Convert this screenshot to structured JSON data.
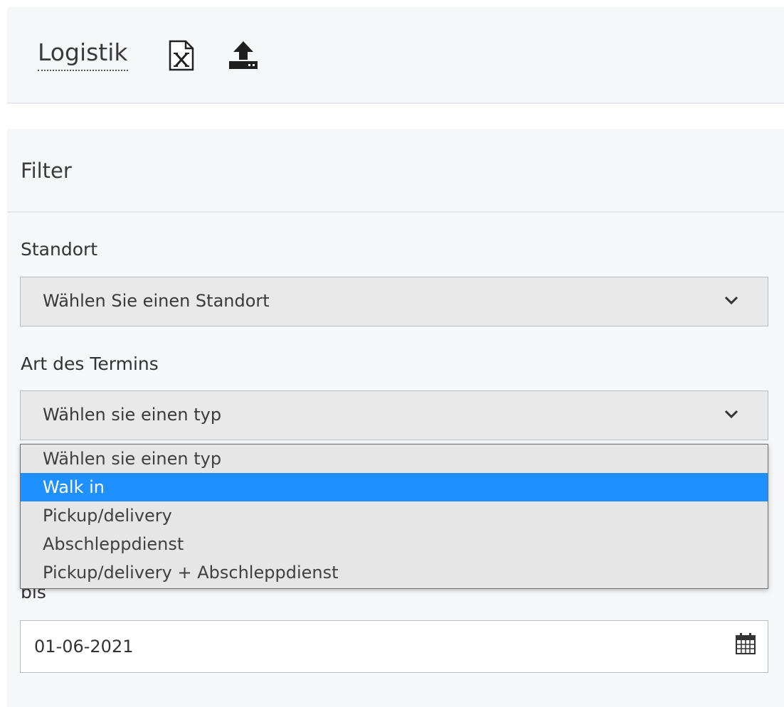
{
  "header": {
    "title": "Logistik",
    "icons": [
      "excel-export-icon",
      "upload-icon"
    ]
  },
  "filter": {
    "title": "Filter",
    "standort": {
      "label": "Standort",
      "selected": "Wählen Sie einen Standort"
    },
    "termin_art": {
      "label": "Art des Termins",
      "selected": "Wählen sie einen typ",
      "options": [
        "Wählen sie einen typ",
        "Walk in",
        "Pickup/delivery",
        "Abschleppdienst",
        "Pickup/delivery + Abschleppdienst"
      ],
      "highlighted_option": "Walk in"
    },
    "bis": {
      "label": "bis",
      "value": "01-06-2021"
    }
  },
  "colors": {
    "highlight": "#1e90ff",
    "panel_bg": "#f6f7f9",
    "select_bg": "#e9e9e9"
  }
}
